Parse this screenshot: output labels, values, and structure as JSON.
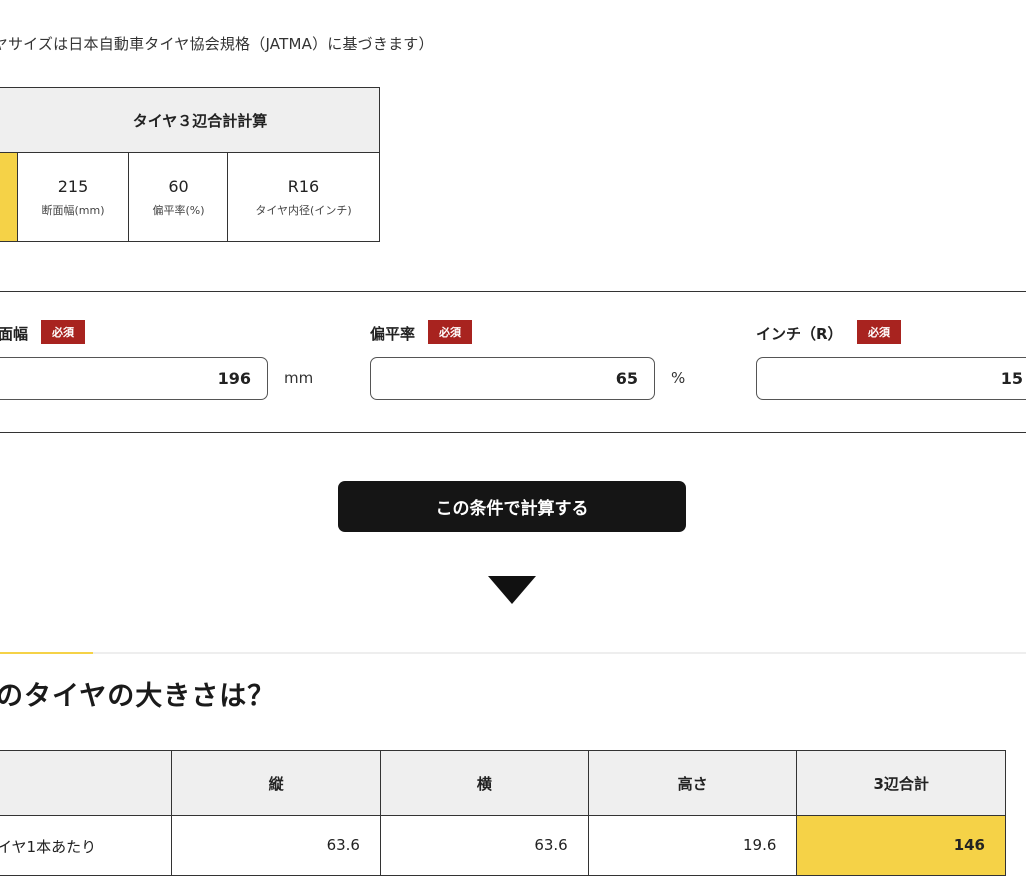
{
  "note": "イヤサイズは日本自動車タイヤ協会規格（JATMA）に基づきます）",
  "example": {
    "title": "タイヤ３辺合計計算",
    "cells": [
      {
        "value": "215",
        "label": "断面幅(mm)"
      },
      {
        "value": "60",
        "label": "偏平率(%)"
      },
      {
        "value": "R16",
        "label": "タイヤ内径(インチ)"
      }
    ]
  },
  "form": {
    "required_label": "必須",
    "fields": [
      {
        "label": "面幅",
        "value": "196",
        "unit": "mm"
      },
      {
        "label": "偏平率",
        "value": "65",
        "unit": "%"
      },
      {
        "label": "インチ（R）",
        "value": "15",
        "unit": ""
      }
    ],
    "submit_label": "この条件で計算する"
  },
  "result": {
    "title": "のタイヤの大きさは？",
    "headers": [
      "",
      "縦",
      "横",
      "高さ",
      "3辺合計"
    ],
    "rows": [
      {
        "label": "イヤ1本あたり",
        "values": [
          "63.6",
          "63.6",
          "19.6",
          "146"
        ]
      }
    ]
  },
  "colors": {
    "accent_yellow": "#f5d247",
    "required_badge": "#a8231f",
    "button_bg": "#151515"
  }
}
